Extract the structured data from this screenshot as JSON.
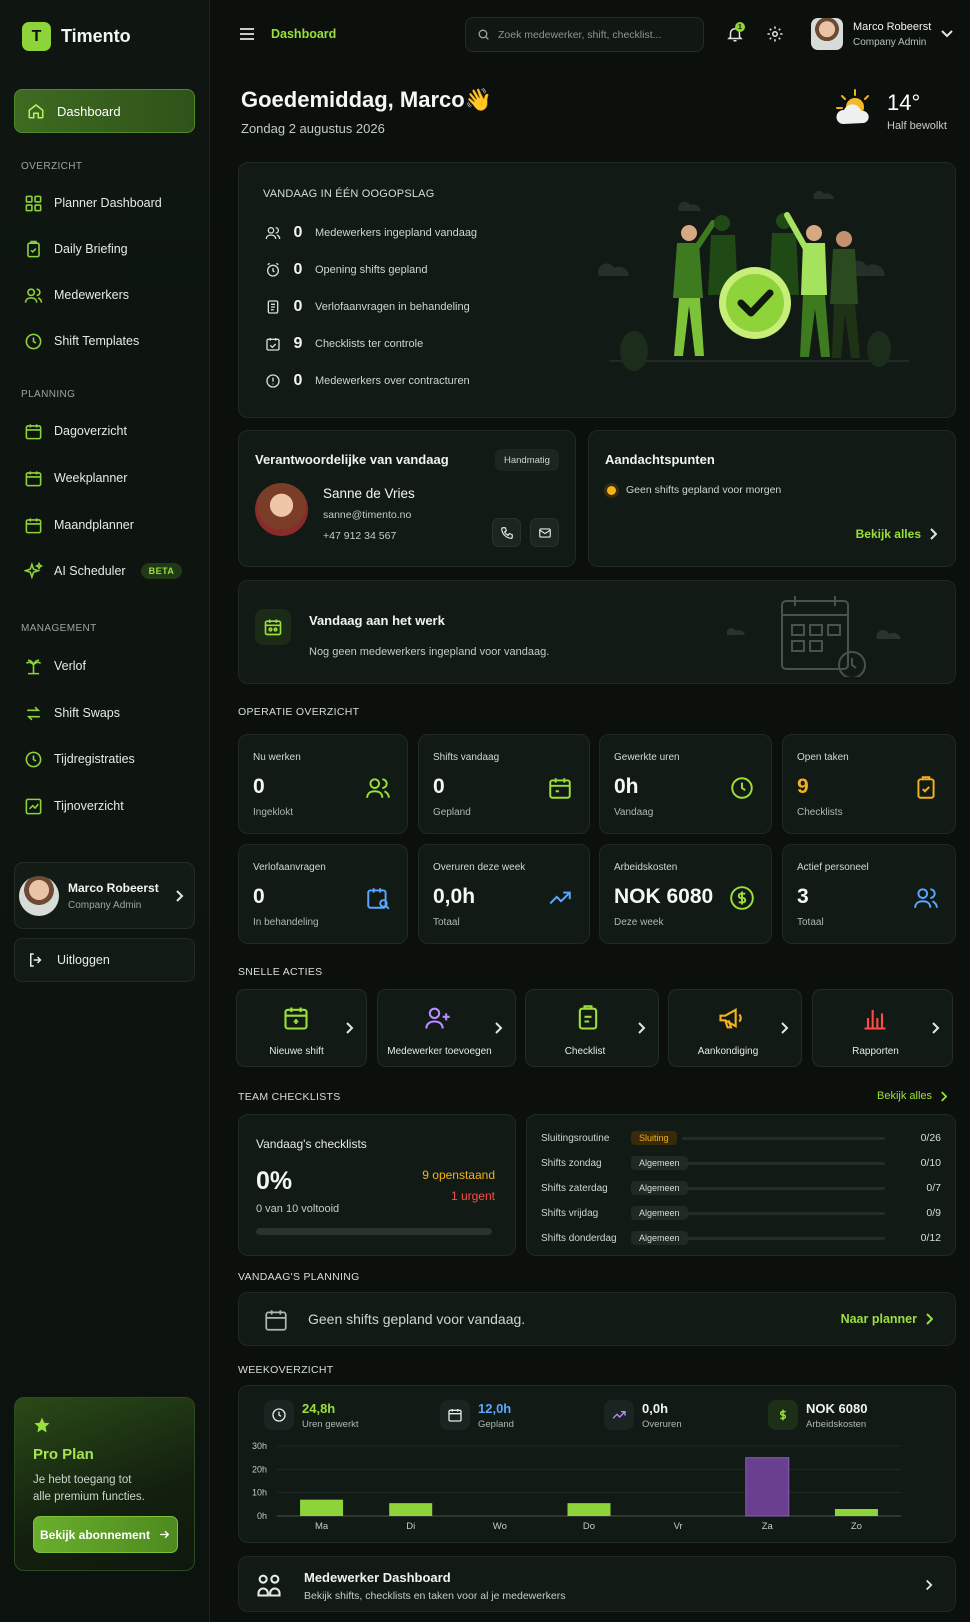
{
  "app": {
    "name": "Timento",
    "logo_letter": "T"
  },
  "sidebar": {
    "active": "Dashboard",
    "sections": {
      "overview": "OVERZICHT",
      "planning": "PLANNING",
      "management": "MANAGEMENT"
    },
    "overview_items": [
      "Planner Dashboard",
      "Daily Briefing",
      "Medewerkers",
      "Shift Templates"
    ],
    "planning_items": [
      "Dagoverzicht",
      "Weekplanner",
      "Maandplanner",
      "AI Scheduler"
    ],
    "beta_badge": "BETA",
    "management_items": [
      "Verlof",
      "Shift Swaps",
      "Tijdregistraties",
      "Tijnoverzicht"
    ],
    "user": {
      "name": "Marco Robeerst",
      "role": "Company Admin"
    },
    "logout": "Uitloggen",
    "pro": {
      "title": "Pro Plan",
      "desc_line1": "Je hebt toegang tot",
      "desc_line2": "alle premium functies.",
      "button": "Bekijk abonnement"
    }
  },
  "topbar": {
    "breadcrumb": "Dashboard",
    "search_placeholder": "Zoek medewerker, shift, checklist...",
    "notifications": "1",
    "user": {
      "name": "Marco Robeerst",
      "role": "Company Admin"
    }
  },
  "greeting": {
    "text": "Goedemiddag, Marco",
    "wave": "👋",
    "date": "Zondag 2 augustus 2026"
  },
  "weather": {
    "temp": "14°",
    "desc": "Half bewolkt"
  },
  "glance": {
    "title": "VANDAAG IN ÉÉN OOGOPSLAG",
    "rows": [
      {
        "value": "0",
        "label": "Medewerkers ingepland vandaag"
      },
      {
        "value": "0",
        "label": "Opening shifts gepland"
      },
      {
        "value": "0",
        "label": "Verlofaanvragen in behandeling"
      },
      {
        "value": "9",
        "label": "Checklists ter controle"
      },
      {
        "value": "0",
        "label": "Medewerkers over contracturen"
      }
    ]
  },
  "responsible": {
    "title": "Verantwoordelijke van vandaag",
    "mode": "Handmatig",
    "name": "Sanne de Vries",
    "email": "sanne@timento.no",
    "phone": "+47 912 34 567"
  },
  "attention": {
    "title": "Aandachtspunten",
    "item": "Geen shifts gepland voor morgen",
    "link": "Bekijk alles"
  },
  "at_work": {
    "title": "Vandaag aan het werk",
    "desc": "Nog geen medewerkers ingepland voor vandaag."
  },
  "operations": {
    "title": "OPERATIE OVERZICHT",
    "cards": [
      {
        "label": "Nu werken",
        "value": "0",
        "sub": "Ingeklokt"
      },
      {
        "label": "Shifts vandaag",
        "value": "0",
        "sub": "Gepland"
      },
      {
        "label": "Gewerkte uren",
        "value": "0h",
        "sub": "Vandaag"
      },
      {
        "label": "Open taken",
        "value": "9",
        "sub": "Checklists"
      },
      {
        "label": "Verlofaanvragen",
        "value": "0",
        "sub": "In behandeling"
      },
      {
        "label": "Overuren deze week",
        "value": "0,0h",
        "sub": "Totaal"
      },
      {
        "label": "Arbeidskosten",
        "value": "NOK 6080",
        "sub": "Deze week"
      },
      {
        "label": "Actief personeel",
        "value": "3",
        "sub": "Totaal"
      }
    ]
  },
  "quick_actions": {
    "title": "SNELLE ACTIES",
    "items": [
      "Nieuwe shift",
      "Medewerker toevoegen",
      "Checklist",
      "Aankondiging",
      "Rapporten"
    ]
  },
  "checklists": {
    "title": "TEAM CHECKLISTS",
    "link": "Bekijk alles",
    "summary": {
      "title": "Vandaag's checklists",
      "percent": "0%",
      "done": "0 van 10 voltooid",
      "open": "9 openstaand",
      "urgent": "1 urgent",
      "progress": 0
    },
    "rows": [
      {
        "name": "Sluitingsroutine",
        "tag": "Sluiting",
        "count": "0/26"
      },
      {
        "name": "Shifts zondag",
        "tag": "Algemeen",
        "count": "0/10"
      },
      {
        "name": "Shifts zaterdag",
        "tag": "Algemeen",
        "count": "0/7"
      },
      {
        "name": "Shifts vrijdag",
        "tag": "Algemeen",
        "count": "0/9"
      },
      {
        "name": "Shifts donderdag",
        "tag": "Algemeen",
        "count": "0/12"
      }
    ]
  },
  "planning": {
    "title": "VANDAAG'S PLANNING",
    "empty": "Geen shifts gepland voor vandaag.",
    "link": "Naar planner"
  },
  "week": {
    "title": "WEEKOVERZICHT",
    "stats": [
      {
        "value": "24,8h",
        "label": "Uren gewerkt",
        "color": "#9be03a"
      },
      {
        "value": "12,0h",
        "label": "Gepland",
        "color": "#5aa7ff"
      },
      {
        "value": "0,0h",
        "label": "Overuren",
        "color": "#f0f4f1"
      },
      {
        "value": "NOK 6080",
        "label": "Arbeidskosten",
        "color": "#f0f4f1"
      }
    ]
  },
  "chart_data": {
    "type": "bar",
    "categories": [
      "Ma",
      "Di",
      "Wo",
      "Do",
      "Vr",
      "Za",
      "Zo"
    ],
    "values": [
      7,
      5.5,
      0,
      5.5,
      0,
      25,
      3
    ],
    "highlight_index": 5,
    "ylim": [
      0,
      30
    ],
    "yticks": [
      "30h",
      "20h",
      "10h",
      "0h"
    ],
    "colors": {
      "bar": "#8fd33a",
      "highlight": "#6b3f8f"
    }
  },
  "employee_dashboard": {
    "title": "Medewerker Dashboard",
    "desc": "Bekijk shifts, checklists en taken voor al je medewerkers"
  }
}
